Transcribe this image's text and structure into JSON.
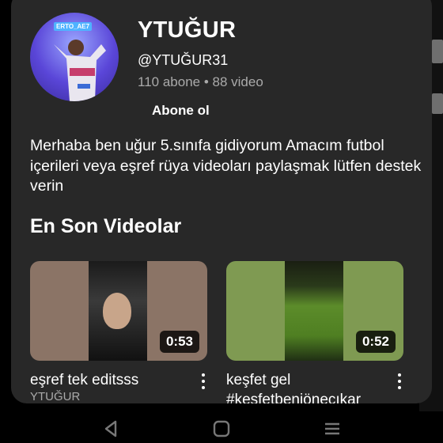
{
  "channel": {
    "avatar_text": "ERTO_AE7",
    "name": "YTUĞUR",
    "handle": "@YTUĞUR31",
    "stats": "110 abone • 88 video",
    "subscribe_label": "Abone ol",
    "description": "Merhaba ben uğur 5.sınıfa gidiyorum Amacım futbol içerileri veya eşref rüya videoları paylaşmak lütfen destek verin"
  },
  "section": {
    "title": "En Son Videolar"
  },
  "videos": [
    {
      "title": "eşref tek editsss",
      "duration": "0:53",
      "meta": "YTUĞUR"
    },
    {
      "title": "keşfet gel #keşfetbeniönecıkar",
      "duration": "0:52",
      "meta": ""
    }
  ],
  "peek": {
    "title_start": "e"
  },
  "colors": {
    "card_bg": "#282828",
    "secondary_text": "#aaaaaa",
    "accent": "#ffffff"
  },
  "icons": [
    "back-icon",
    "home-icon",
    "recents-icon",
    "more-vert-icon"
  ]
}
